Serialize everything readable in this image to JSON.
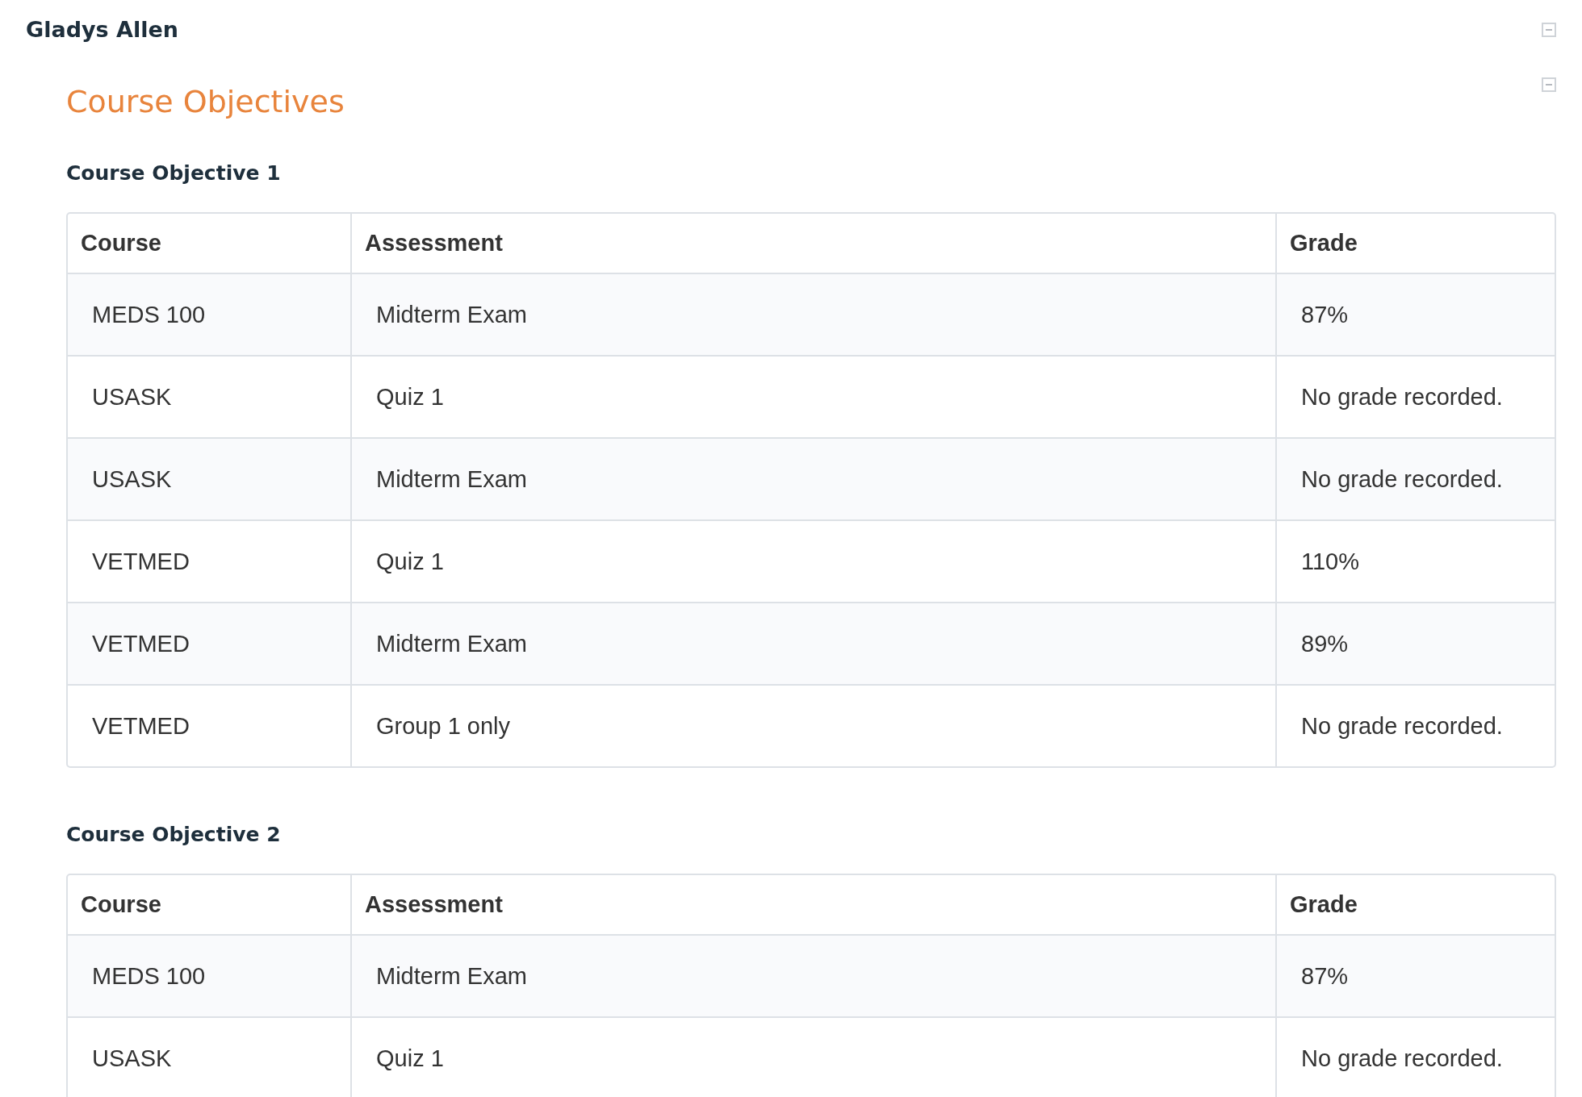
{
  "student": {
    "name": "Gladys Allen",
    "expanded": true
  },
  "section": {
    "title": "Course Objectives",
    "expanded": true
  },
  "objectives": [
    {
      "title": "Course Objective 1",
      "table": {
        "columns": [
          "Course",
          "Assessment",
          "Grade"
        ],
        "rows": [
          [
            "MEDS 100",
            "Midterm Exam",
            "87%"
          ],
          [
            "USASK",
            "Quiz 1",
            "No grade recorded."
          ],
          [
            "USASK",
            "Midterm Exam",
            "No grade recorded."
          ],
          [
            "VETMED",
            "Quiz 1",
            "110%"
          ],
          [
            "VETMED",
            "Midterm Exam",
            "89%"
          ],
          [
            "VETMED",
            "Group 1 only",
            "No grade recorded."
          ]
        ]
      }
    },
    {
      "title": "Course Objective 2",
      "table": {
        "columns": [
          "Course",
          "Assessment",
          "Grade"
        ],
        "rows": [
          [
            "MEDS 100",
            "Midterm Exam",
            "87%"
          ],
          [
            "USASK",
            "Quiz 1",
            "No grade recorded."
          ]
        ]
      }
    }
  ]
}
